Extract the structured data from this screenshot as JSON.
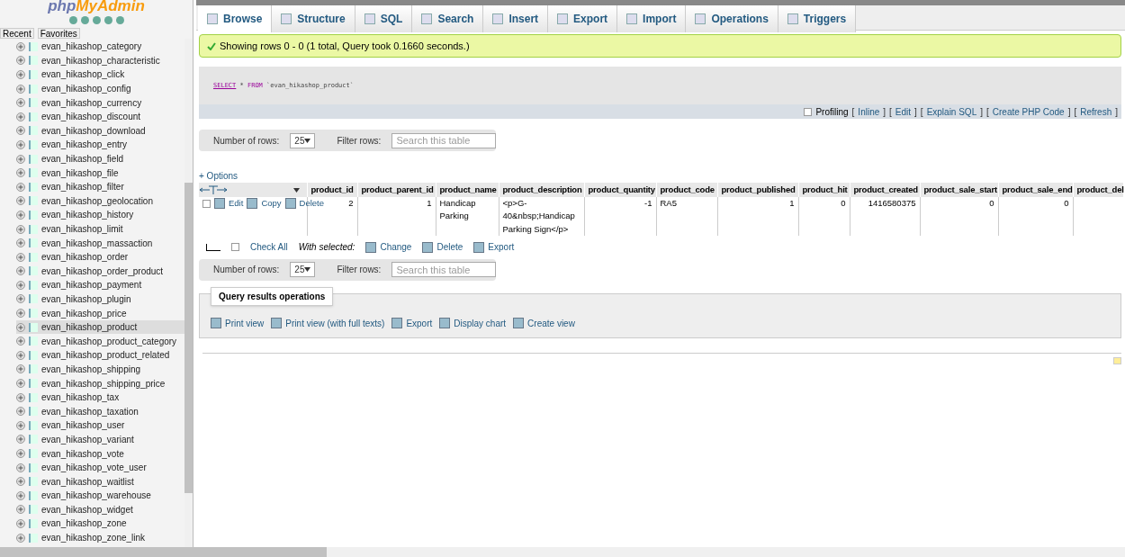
{
  "logo": {
    "php": "php",
    "myadmin": "MyAdmin"
  },
  "nav_tabs": [
    {
      "label": "Recent",
      "selected": false
    },
    {
      "label": "Favorites",
      "selected": false
    }
  ],
  "sidebar": {
    "items": [
      {
        "label": "evan_hikashop_category",
        "selected": false
      },
      {
        "label": "evan_hikashop_characteristic",
        "selected": false
      },
      {
        "label": "evan_hikashop_click",
        "selected": false
      },
      {
        "label": "evan_hikashop_config",
        "selected": false
      },
      {
        "label": "evan_hikashop_currency",
        "selected": false
      },
      {
        "label": "evan_hikashop_discount",
        "selected": false
      },
      {
        "label": "evan_hikashop_download",
        "selected": false
      },
      {
        "label": "evan_hikashop_entry",
        "selected": false
      },
      {
        "label": "evan_hikashop_field",
        "selected": false
      },
      {
        "label": "evan_hikashop_file",
        "selected": false
      },
      {
        "label": "evan_hikashop_filter",
        "selected": false
      },
      {
        "label": "evan_hikashop_geolocation",
        "selected": false
      },
      {
        "label": "evan_hikashop_history",
        "selected": false
      },
      {
        "label": "evan_hikashop_limit",
        "selected": false
      },
      {
        "label": "evan_hikashop_massaction",
        "selected": false
      },
      {
        "label": "evan_hikashop_order",
        "selected": false
      },
      {
        "label": "evan_hikashop_order_product",
        "selected": false
      },
      {
        "label": "evan_hikashop_payment",
        "selected": false
      },
      {
        "label": "evan_hikashop_plugin",
        "selected": false
      },
      {
        "label": "evan_hikashop_price",
        "selected": false
      },
      {
        "label": "evan_hikashop_product",
        "selected": true
      },
      {
        "label": "evan_hikashop_product_category",
        "selected": false
      },
      {
        "label": "evan_hikashop_product_related",
        "selected": false
      },
      {
        "label": "evan_hikashop_shipping",
        "selected": false
      },
      {
        "label": "evan_hikashop_shipping_price",
        "selected": false
      },
      {
        "label": "evan_hikashop_tax",
        "selected": false
      },
      {
        "label": "evan_hikashop_taxation",
        "selected": false
      },
      {
        "label": "evan_hikashop_user",
        "selected": false
      },
      {
        "label": "evan_hikashop_variant",
        "selected": false
      },
      {
        "label": "evan_hikashop_vote",
        "selected": false
      },
      {
        "label": "evan_hikashop_vote_user",
        "selected": false
      },
      {
        "label": "evan_hikashop_waitlist",
        "selected": false
      },
      {
        "label": "evan_hikashop_warehouse",
        "selected": false
      },
      {
        "label": "evan_hikashop_widget",
        "selected": false
      },
      {
        "label": "evan_hikashop_zone",
        "selected": false
      },
      {
        "label": "evan_hikashop_zone_link",
        "selected": false
      }
    ]
  },
  "tabs": [
    {
      "label": "Browse",
      "selected": true
    },
    {
      "label": "Structure",
      "selected": false
    },
    {
      "label": "SQL",
      "selected": false
    },
    {
      "label": "Search",
      "selected": false
    },
    {
      "label": "Insert",
      "selected": false
    },
    {
      "label": "Export",
      "selected": false
    },
    {
      "label": "Import",
      "selected": false
    },
    {
      "label": "Operations",
      "selected": false
    },
    {
      "label": "Triggers",
      "selected": false
    }
  ],
  "success_message": "Showing rows 0 - 0 (1 total, Query took 0.1660 seconds.)",
  "sql": {
    "keyword1": "SELECT",
    "rest": " * ",
    "keyword2": "FROM",
    "table": " `evan_hikashop_product`"
  },
  "profiling": {
    "label": "Profiling",
    "checked": false,
    "items": [
      {
        "kind": "bracket",
        "text": "["
      },
      {
        "kind": "link",
        "text": "Inline"
      },
      {
        "kind": "bracket",
        "text": "]"
      },
      {
        "kind": "bracket",
        "text": "["
      },
      {
        "kind": "link",
        "text": "Edit"
      },
      {
        "kind": "bracket",
        "text": "]"
      },
      {
        "kind": "bracket",
        "text": "["
      },
      {
        "kind": "link",
        "text": "Explain SQL"
      },
      {
        "kind": "bracket",
        "text": "]"
      },
      {
        "kind": "bracket",
        "text": "["
      },
      {
        "kind": "link",
        "text": "Create PHP Code"
      },
      {
        "kind": "bracket",
        "text": "]"
      },
      {
        "kind": "bracket",
        "text": "["
      },
      {
        "kind": "link",
        "text": "Refresh"
      },
      {
        "kind": "bracket",
        "text": "]"
      }
    ]
  },
  "row_controls_top": {
    "number_label": "Number of rows:",
    "number_value": "25",
    "filter_label": "Filter rows:",
    "filter_placeholder": "Search this table"
  },
  "row_controls_bottom": {
    "number_label": "Number of rows:",
    "number_value": "25",
    "filter_label": "Filter rows:",
    "filter_placeholder": "Search this table"
  },
  "options_link": "+ Options",
  "table": {
    "columns": [
      "product_id",
      "product_parent_id",
      "product_name",
      "product_description",
      "product_quantity",
      "product_code",
      "product_published",
      "product_hit",
      "product_created",
      "product_sale_start",
      "product_sale_end",
      "product_del"
    ],
    "rows": [
      {
        "checked": false,
        "actions": [
          "Edit",
          "Copy",
          "Delete"
        ],
        "cells": [
          "2",
          "1",
          "Handicap Parking",
          "<p>G-40&nbsp;Handicap Parking Sign</p>",
          "-1",
          "RA5",
          "1",
          "0",
          "1416580375",
          "0",
          "0",
          ""
        ]
      }
    ]
  },
  "bulk": {
    "check_all_checked": false,
    "check_all": "Check All",
    "with_selected": "With selected:",
    "actions": [
      "Change",
      "Delete",
      "Export"
    ]
  },
  "query_ops": {
    "title": "Query results operations",
    "actions": [
      "Print view",
      "Print view (with full texts)",
      "Export",
      "Display chart",
      "Create view"
    ]
  }
}
